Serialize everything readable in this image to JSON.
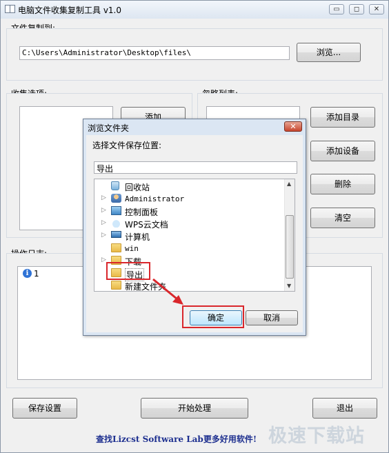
{
  "window": {
    "title": "电脑文件收集复制工具 v1.0",
    "controls": {
      "minimize": "▭",
      "maximize": "◻",
      "close": "✕"
    }
  },
  "copy_to": {
    "label": "文件复制到:",
    "path": "C:\\Users\\Administrator\\Desktop\\files\\",
    "browse_label": "浏览..."
  },
  "collect": {
    "label": "收集选项:",
    "add_label": "添加"
  },
  "ignore": {
    "label": "忽略列表:",
    "buttons": [
      "添加目录",
      "添加设备",
      "删除",
      "清空"
    ]
  },
  "log": {
    "label": "操作日志:",
    "entries": [
      "1"
    ]
  },
  "bottom": {
    "save": "保存设置",
    "start": "开始处理",
    "exit": "退出"
  },
  "footer_link": "查找Lizcst Software Lab更多好用软件!",
  "watermark": "极速下载站",
  "dialog": {
    "title": "浏览文件夹",
    "close": "✕",
    "prompt": "选择文件保存位置:",
    "input_value": "导出",
    "tree": [
      {
        "label": "回收站",
        "icon": "recycle-bin-icon",
        "expand": false
      },
      {
        "label": "Administrator",
        "icon": "user-folder-icon",
        "expand": true
      },
      {
        "label": "控制面板",
        "icon": "control-panel-icon",
        "expand": true
      },
      {
        "label": "WPS云文档",
        "icon": "cloud-icon",
        "expand": true
      },
      {
        "label": "计算机",
        "icon": "computer-icon",
        "expand": true
      },
      {
        "label": "win",
        "icon": "folder-icon",
        "expand": false
      },
      {
        "label": "下载",
        "icon": "folder-icon",
        "expand": true
      },
      {
        "label": "导出",
        "icon": "folder-icon",
        "expand": false,
        "selected": true
      },
      {
        "label": "新建文件夹",
        "icon": "folder-icon",
        "expand": false
      }
    ],
    "ok": "确定",
    "cancel": "取消"
  },
  "colors": {
    "annotation": "#d9262b",
    "accent": "#2f73d6"
  }
}
